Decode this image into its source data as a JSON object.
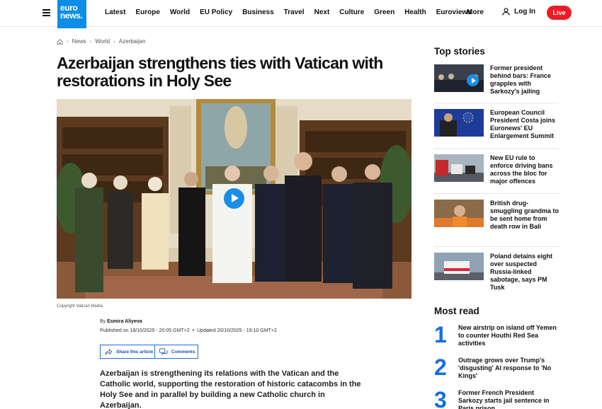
{
  "header": {
    "logo_line1": "euro",
    "logo_line2": "news.",
    "nav": [
      "Latest",
      "Europe",
      "World",
      "EU Policy",
      "Business",
      "Travel",
      "Next",
      "Culture",
      "Green",
      "Health",
      "Euroviews"
    ],
    "more_label": "More",
    "login_label": "Log In",
    "live_label": "Live"
  },
  "breadcrumb": [
    "News",
    "World",
    "Azerbaijan"
  ],
  "article": {
    "title": "Azerbaijan strengthens ties with Vatican with restorations in Holy See",
    "caption": "Copyright Vatican Media",
    "by_prefix": "By ",
    "author": "Esmira Aliyeva",
    "published": "Published on 18/10/2025 - 20:05 GMT+2",
    "updated": "Updated 20/10/2025 - 19:10 GMT+2",
    "share_label": "Share this article",
    "comments_label": "Comments",
    "lead": "Azerbaijan is strengthening its relations with the Vatican and the Catholic world, supporting the restoration of historic catacombs in the Holy See and in parallel by building a new Catholic church in Azerbaijan."
  },
  "sidebar": {
    "top_stories_title": "Top stories",
    "top_stories": [
      {
        "text": "Former president behind bars: France grapples with Sarkozy's jailing",
        "video": true
      },
      {
        "text": "European Council President Costa joins Euronews' EU Enlargement Summit",
        "video": false
      },
      {
        "text": "New EU rule to enforce driving bans across the bloc for major offences",
        "video": false
      },
      {
        "text": "British drug-smuggling grandma to be sent home from death row in Bali",
        "video": false
      },
      {
        "text": "Poland detains eight over suspected Russia-linked sabotage, says PM Tusk",
        "video": false
      }
    ],
    "most_read_title": "Most read",
    "most_read": [
      {
        "num": "1",
        "text": "New airstrip on island off Yemen to counter Houthi Red Sea activities"
      },
      {
        "num": "2",
        "text": "Outrage grows over Trump's 'disgusting' AI response to 'No Kings'"
      },
      {
        "num": "3",
        "text": "Former French President Sarkozy starts jail sentence in Paris prison"
      }
    ]
  }
}
